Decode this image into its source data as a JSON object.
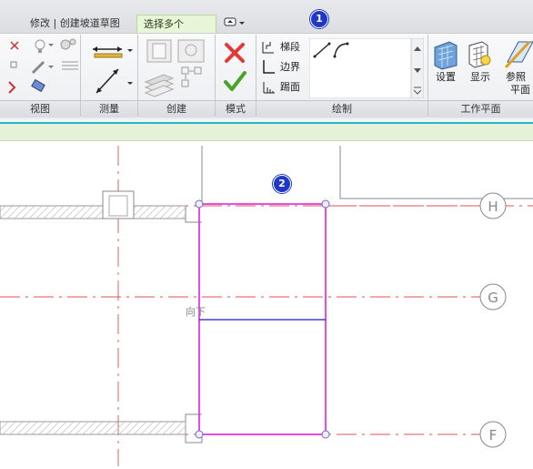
{
  "tabs": {
    "main_label": "修改 | 创建坡道草图",
    "select_multiple_label": "选择多个",
    "dropdown_glyph": "▾"
  },
  "panels": {
    "view": "视图",
    "measure": "测量",
    "create": "创建",
    "mode": "模式",
    "draw": "绘制",
    "workplane": "工作平面"
  },
  "draw_tools": {
    "run": "梯段",
    "boundary": "边界",
    "riser": "踢面"
  },
  "workplane_tools": {
    "set": "设置",
    "show": "显示",
    "ref_plane_line1": "参照",
    "ref_plane_line2": "平面"
  },
  "callouts": [
    "1",
    "2"
  ],
  "canvas": {
    "direction_label": "向下",
    "grid_labels": [
      "H",
      "G",
      "F"
    ]
  },
  "colors": {
    "sketch_boundary": "#e020e0",
    "riser_line": "#1c1cc8",
    "grid_line": "#e05050",
    "accent": "#27b3c8"
  }
}
